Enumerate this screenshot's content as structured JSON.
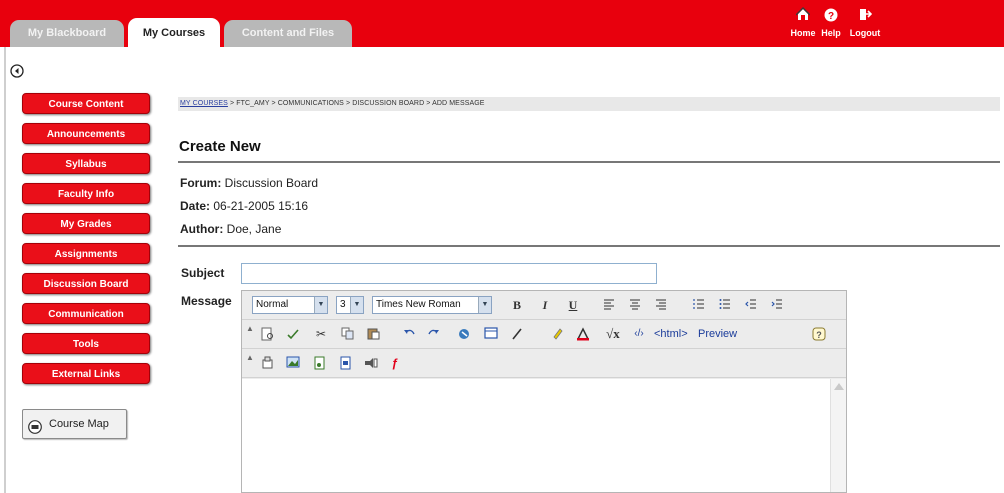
{
  "tabs": [
    {
      "label": "My Blackboard",
      "active": false
    },
    {
      "label": "My Courses",
      "active": true
    },
    {
      "label": "Content and Files",
      "active": false
    }
  ],
  "utility": {
    "home": "Home",
    "help": "Help",
    "logout": "Logout"
  },
  "nav": [
    "Course Content",
    "Announcements",
    "Syllabus",
    "Faculty Info",
    "My Grades",
    "Assignments",
    "Discussion Board",
    "Communication",
    "Tools",
    "External Links"
  ],
  "course_map": "Course Map",
  "breadcrumb": {
    "link": "MY COURSES",
    "rest": " > FTC_AMY > COMMUNICATIONS > DISCUSSION BOARD > ADD MESSAGE"
  },
  "title": "Create New",
  "meta": {
    "forum_label": "Forum:",
    "forum": "Discussion Board",
    "date_label": "Date:",
    "date": "06-21-2005 15:16",
    "author_label": "Author:",
    "author": "Doe, Jane"
  },
  "form": {
    "subject_label": "Subject",
    "subject_value": "",
    "message_label": "Message"
  },
  "editor": {
    "format": "Normal",
    "size": "3",
    "font": "Times New Roman",
    "html_label": "<html>",
    "preview_label": "Preview"
  },
  "colors": {
    "brand_red": "#e8000d",
    "tab_gray": "#b8b8b8",
    "link_blue": "#2a3fa0"
  }
}
